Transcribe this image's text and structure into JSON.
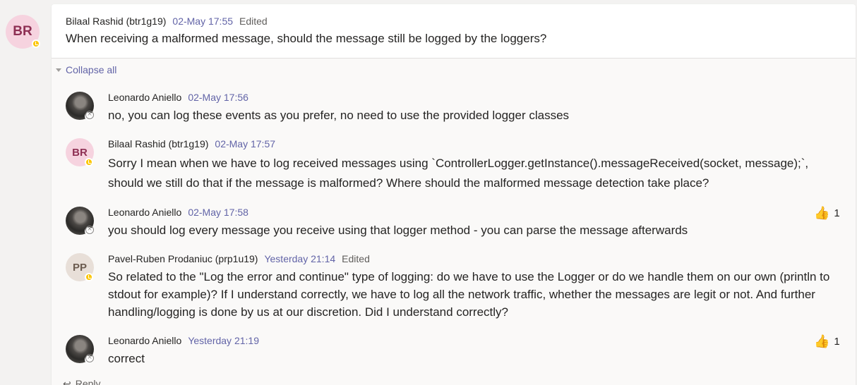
{
  "root": {
    "avatar_initials": "BR",
    "author": "Bilaal Rashid (btr1g19)",
    "time": "02-May 17:55",
    "edited": "Edited",
    "message": "When receiving a malformed message, should the message still be logged by the loggers?"
  },
  "collapse_label": "Collapse all",
  "replies": [
    {
      "author": "Leonardo Aniello",
      "time": "02-May 17:56",
      "message": "no, you can log these events as you prefer, no need to use the provided logger classes"
    },
    {
      "avatar_initials": "BR",
      "author": "Bilaal Rashid (btr1g19)",
      "time": "02-May 17:57",
      "message": "Sorry I mean when we have to log received messages using `ControllerLogger.getInstance().messageReceived(socket, message);`, should we still do that if the message is malformed? Where should the malformed message detection take place?"
    },
    {
      "author": "Leonardo Aniello",
      "time": "02-May 17:58",
      "message": "you should log every message you receive using that logger method - you can parse the message afterwards",
      "reaction_count": "1"
    },
    {
      "avatar_initials": "PP",
      "author": "Pavel-Ruben Prodaniuc (prp1u19)",
      "time": "Yesterday 21:14",
      "edited": "Edited",
      "message": "So related to the \"Log the error and continue\" type of logging: do we have to use the Logger or do we handle them on our own (println to stdout for example)? If I understand correctly, we have to log all the network traffic, whether the messages are legit or not. And further handling/logging is done by us at our discretion. Did I understand correctly?"
    },
    {
      "author": "Leonardo Aniello",
      "time": "Yesterday 21:19",
      "message": "correct",
      "reaction_count": "1"
    }
  ],
  "reply_label": "Reply",
  "icons": {
    "reaction": "thumbs-up-icon",
    "collapse": "triangle-down-icon",
    "reply": "reply-arrow-icon"
  },
  "colors": {
    "accent": "#6264a7",
    "away": "#fcc600",
    "reaction": "#f2b31b"
  }
}
